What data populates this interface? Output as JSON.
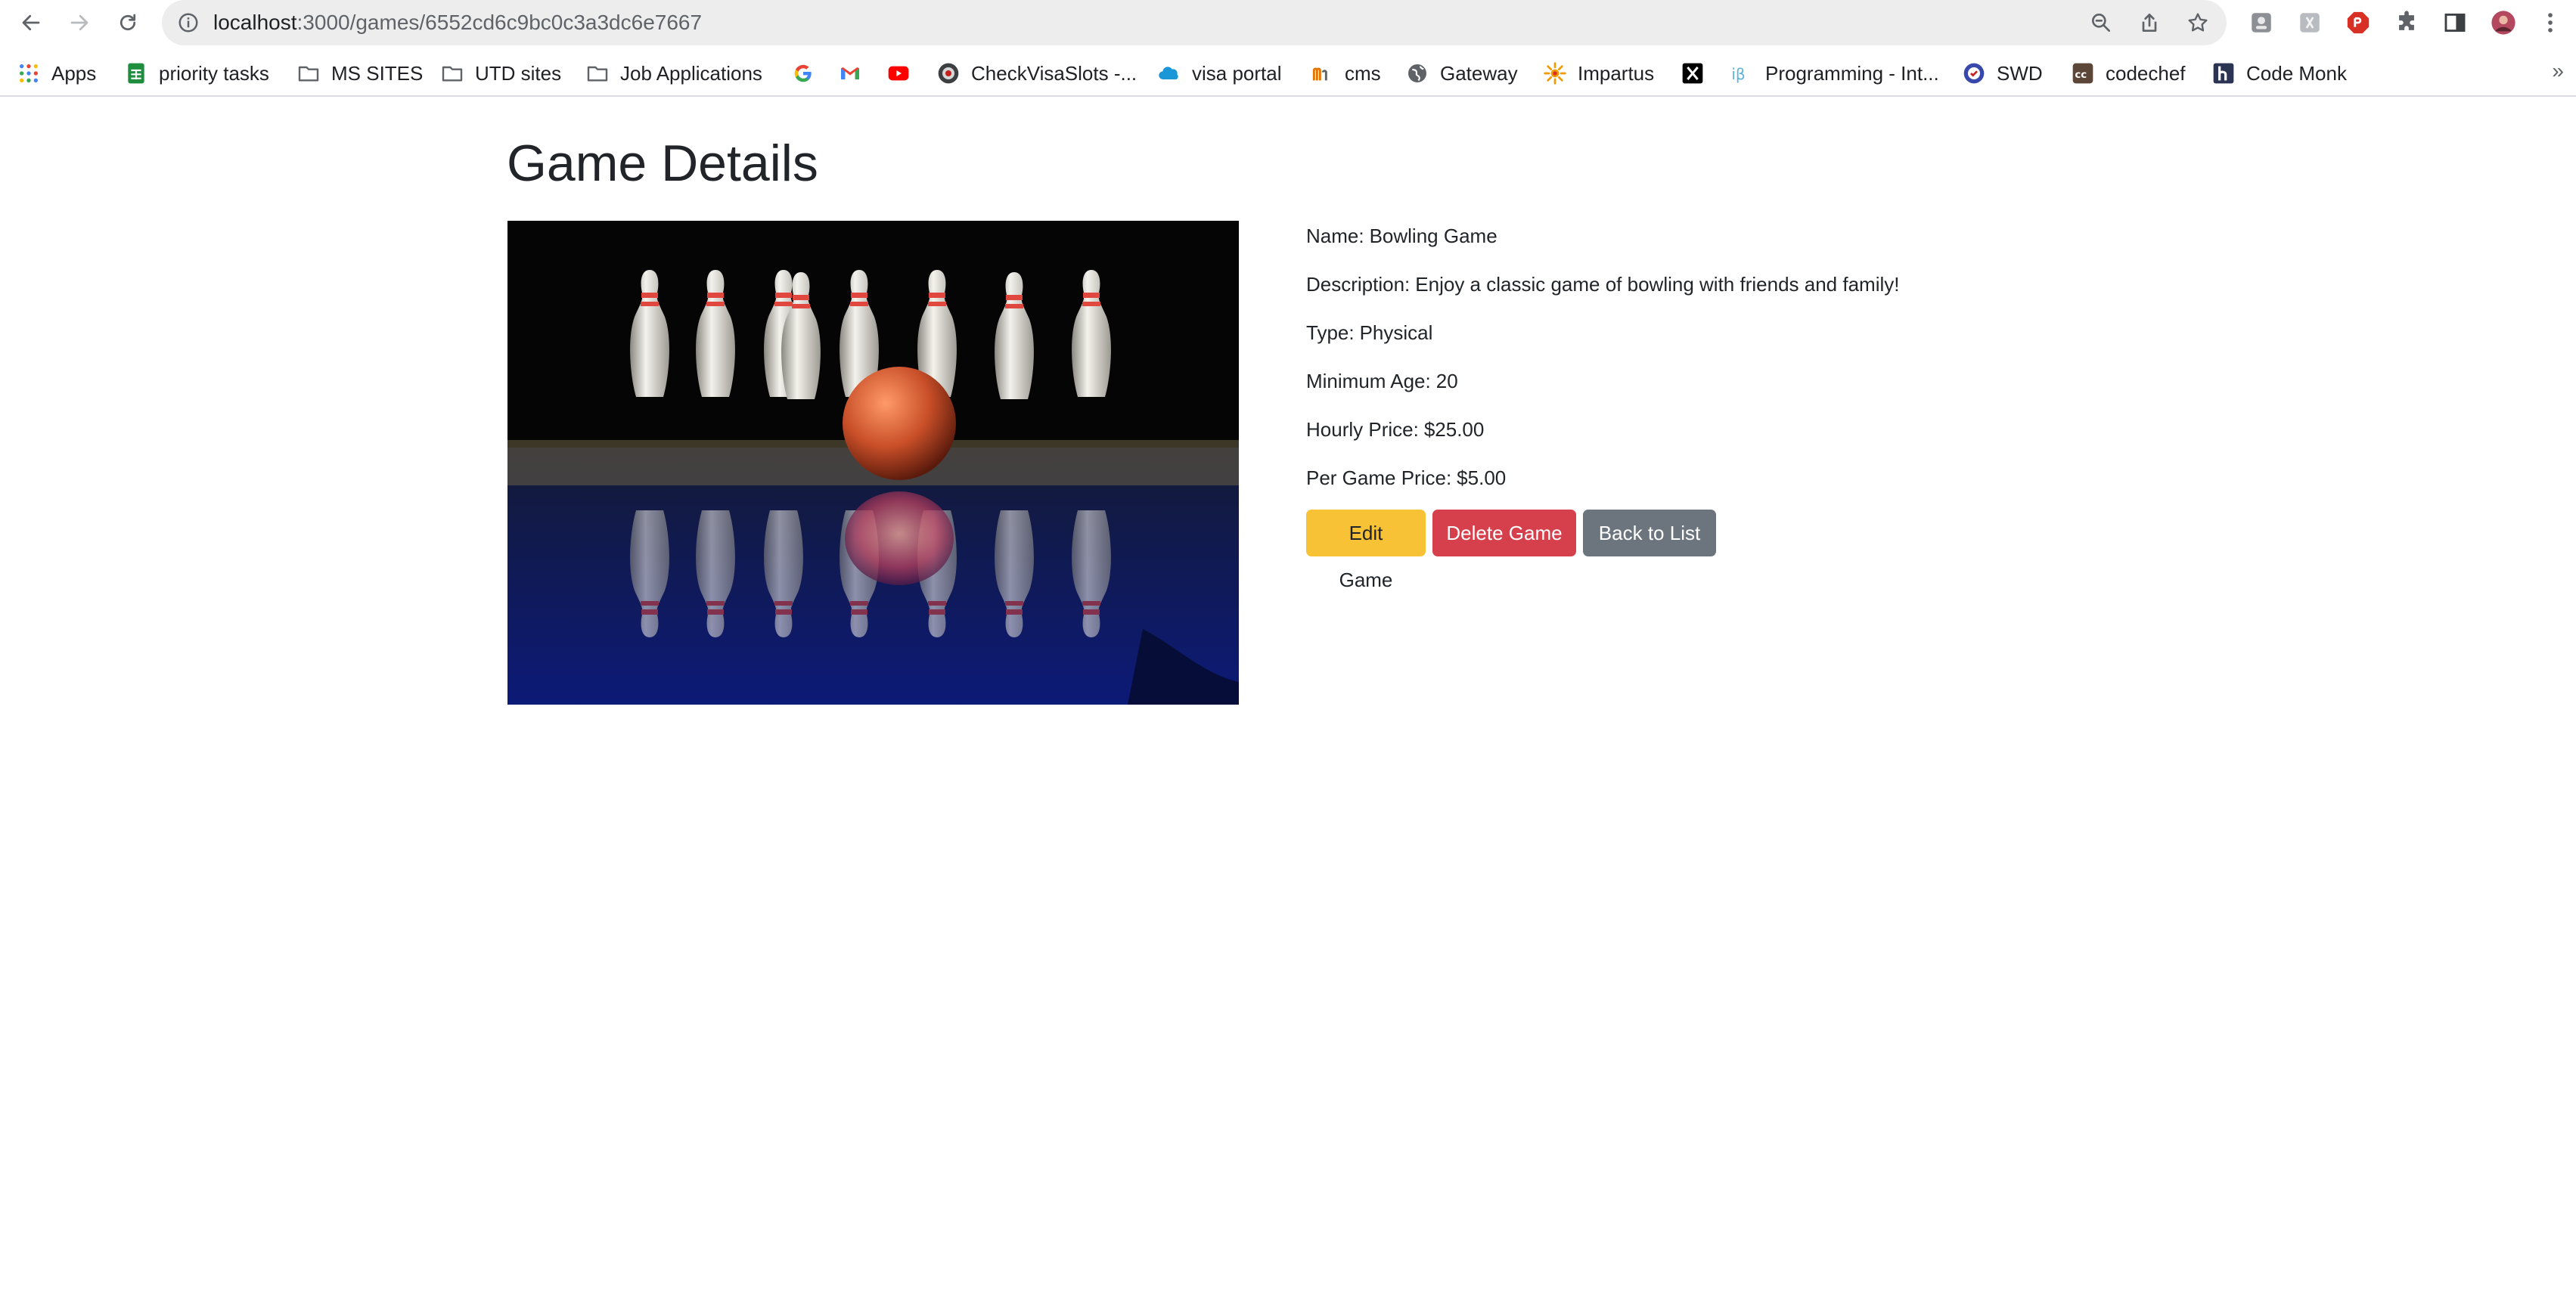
{
  "browser": {
    "url_host": "localhost",
    "url_path": ":3000/games/6552cd6c9bc0c3a3dc6e7667",
    "bookmarks": [
      {
        "label": "Apps",
        "icon": "apps-grid-icon"
      },
      {
        "label": "priority tasks",
        "icon": "sheets-icon"
      },
      {
        "label": "MS SITES",
        "icon": "folder-icon"
      },
      {
        "label": "UTD sites",
        "icon": "folder-icon"
      },
      {
        "label": "Job Applications",
        "icon": "folder-icon"
      },
      {
        "label": "",
        "icon": "google-icon"
      },
      {
        "label": "",
        "icon": "gmail-icon"
      },
      {
        "label": "",
        "icon": "youtube-icon"
      },
      {
        "label": "CheckVisaSlots -...",
        "icon": "checkvisaslots-icon"
      },
      {
        "label": "visa portal",
        "icon": "salesforce-cloud-icon"
      },
      {
        "label": "cms",
        "icon": "cms-icon"
      },
      {
        "label": "Gateway",
        "icon": "globe-icon"
      },
      {
        "label": "Impartus",
        "icon": "impartus-icon"
      },
      {
        "label": "",
        "icon": "x-twitter-icon"
      },
      {
        "label": "Programming - Int...",
        "icon": "interviewbit-icon"
      },
      {
        "label": "SWD",
        "icon": "swd-icon"
      },
      {
        "label": "codechef",
        "icon": "codechef-icon"
      },
      {
        "label": "Code Monk",
        "icon": "hackerearth-icon"
      }
    ],
    "bookmarks_overflow": "»"
  },
  "page": {
    "title": "Game Details",
    "image_alt": "bowling-pins-and-ball",
    "details": [
      {
        "label": "Name:",
        "value": "Bowling Game"
      },
      {
        "label": "Description:",
        "value": "Enjoy a classic game of bowling with friends and family!"
      },
      {
        "label": "Type:",
        "value": "Physical"
      },
      {
        "label": "Minimum Age:",
        "value": "20"
      },
      {
        "label": "Hourly Price:",
        "value": "$25.00"
      },
      {
        "label": "Per Game Price:",
        "value": "$5.00"
      }
    ],
    "buttons": {
      "edit": "Edit Game",
      "delete": "Delete Game",
      "back": "Back to List"
    }
  },
  "colors": {
    "edit_button": "#f7c236",
    "delete_button": "#d5404c",
    "back_button": "#6c757d",
    "heading_text": "#212529"
  }
}
